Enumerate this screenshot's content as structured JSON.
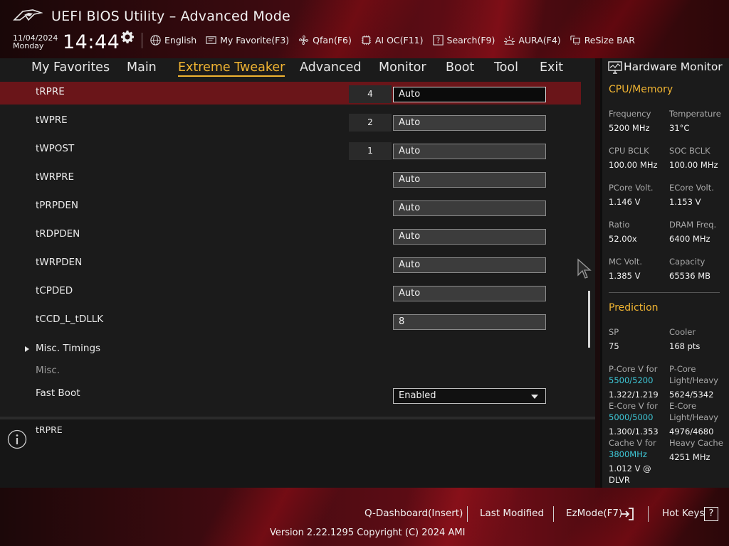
{
  "header": {
    "title": "UEFI BIOS Utility – Advanced Mode",
    "date": "11/04/2024",
    "day": "Monday",
    "time": "14:44",
    "icons": [
      "rog-logo",
      "gear-icon"
    ],
    "toolbar": [
      {
        "label": "English",
        "icon": "globe-icon"
      },
      {
        "label": "My Favorite(F3)",
        "icon": "favorite-icon"
      },
      {
        "label": "Qfan(F6)",
        "icon": "fan-icon"
      },
      {
        "label": "AI OC(F11)",
        "icon": "ai-oc-icon"
      },
      {
        "label": "Search(F9)",
        "icon": "search-icon"
      },
      {
        "label": "AURA(F4)",
        "icon": "aura-icon"
      },
      {
        "label": "ReSize BAR",
        "icon": "resize-bar-icon"
      }
    ]
  },
  "nav": {
    "tabs": [
      "My Favorites",
      "Main",
      "Extreme Tweaker",
      "Advanced",
      "Monitor",
      "Boot",
      "Tool",
      "Exit"
    ],
    "active": "Extreme Tweaker"
  },
  "settings": {
    "rows": [
      {
        "label": "tRPRE",
        "current": "4",
        "value": "Auto"
      },
      {
        "label": "tWPRE",
        "current": "2",
        "value": "Auto"
      },
      {
        "label": "tWPOST",
        "current": "1",
        "value": "Auto"
      },
      {
        "label": "tWRPRE",
        "value": "Auto"
      },
      {
        "label": "tPRPDEN",
        "value": "Auto"
      },
      {
        "label": "tRDPDEN",
        "value": "Auto"
      },
      {
        "label": "tWRPDEN",
        "value": "Auto"
      },
      {
        "label": "tCPDED",
        "value": "Auto"
      },
      {
        "label": "tCCD_L_tDLLK",
        "value": "8"
      }
    ],
    "submenu": "Misc. Timings",
    "group_label": "Misc.",
    "fast_boot": {
      "label": "Fast Boot",
      "value": "Enabled"
    }
  },
  "help": {
    "text": "tRPRE"
  },
  "hw_monitor": {
    "title": "Hardware Monitor",
    "cpu_memory": {
      "title": "CPU/Memory",
      "frequency": {
        "label": "Frequency",
        "value": "5200 MHz"
      },
      "temperature": {
        "label": "Temperature",
        "value": "31°C"
      },
      "cpu_bclk": {
        "label": "CPU BCLK",
        "value": "100.00 MHz"
      },
      "soc_bclk": {
        "label": "SOC BCLK",
        "value": "100.00 MHz"
      },
      "pcore_volt": {
        "label": "PCore Volt.",
        "value": "1.146 V"
      },
      "ecore_volt": {
        "label": "ECore Volt.",
        "value": "1.153 V"
      },
      "ratio": {
        "label": "Ratio",
        "value": "52.00x"
      },
      "dram_freq": {
        "label": "DRAM Freq.",
        "value": "6400 MHz"
      },
      "mc_volt": {
        "label": "MC Volt.",
        "value": "1.385 V"
      },
      "capacity": {
        "label": "Capacity",
        "value": "65536 MB"
      }
    },
    "prediction": {
      "title": "Prediction",
      "sp": {
        "label": "SP",
        "value": "75"
      },
      "cooler": {
        "label": "Cooler",
        "value": "168 pts"
      },
      "pcore_v": {
        "label": "P-Core V for",
        "accent": "5500/5200",
        "value": "1.322/1.219"
      },
      "pcore_lh": {
        "label1": "P-Core",
        "label2": "Light/Heavy",
        "value": "5624/5342"
      },
      "ecore_v": {
        "label": "E-Core V for",
        "accent": "5000/5000",
        "value": "1.300/1.353"
      },
      "ecore_lh": {
        "label1": "E-Core",
        "label2": "Light/Heavy",
        "value": "4976/4680"
      },
      "cache_v": {
        "label": "Cache V for",
        "accent": "3800MHz",
        "value1": "1.012 V @",
        "value2": "DLVR"
      },
      "heavy_cache": {
        "label": "Heavy Cache",
        "value": "4251 MHz"
      }
    }
  },
  "footer": {
    "q_dashboard": "Q-Dashboard(Insert)",
    "last_modified": "Last Modified",
    "ezmode": "EzMode(F7)",
    "hot_keys": "Hot Keys",
    "hot_keys_icon_label": "?",
    "version": "Version 2.22.1295 Copyright (C) 2024 AMI"
  },
  "colors": {
    "accent": "#f0b432",
    "selected_row": "#6a1519",
    "teal": "#3ec8d8"
  }
}
